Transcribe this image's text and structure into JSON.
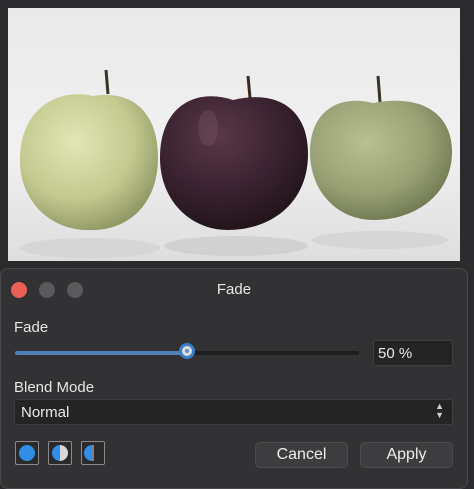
{
  "window": {
    "title": "Fade"
  },
  "fade": {
    "label": "Fade",
    "value_text": "50 %",
    "value": 0.5
  },
  "blend_mode": {
    "label": "Blend Mode",
    "selected": "Normal"
  },
  "buttons": {
    "cancel": "Cancel",
    "apply": "Apply"
  },
  "mode_icons": [
    "full-circle-icon",
    "half-circle-icon",
    "split-circle-icon"
  ],
  "colors": {
    "accent": "#3c7fc4",
    "close": "#ec5f57",
    "panel": "#323234"
  }
}
